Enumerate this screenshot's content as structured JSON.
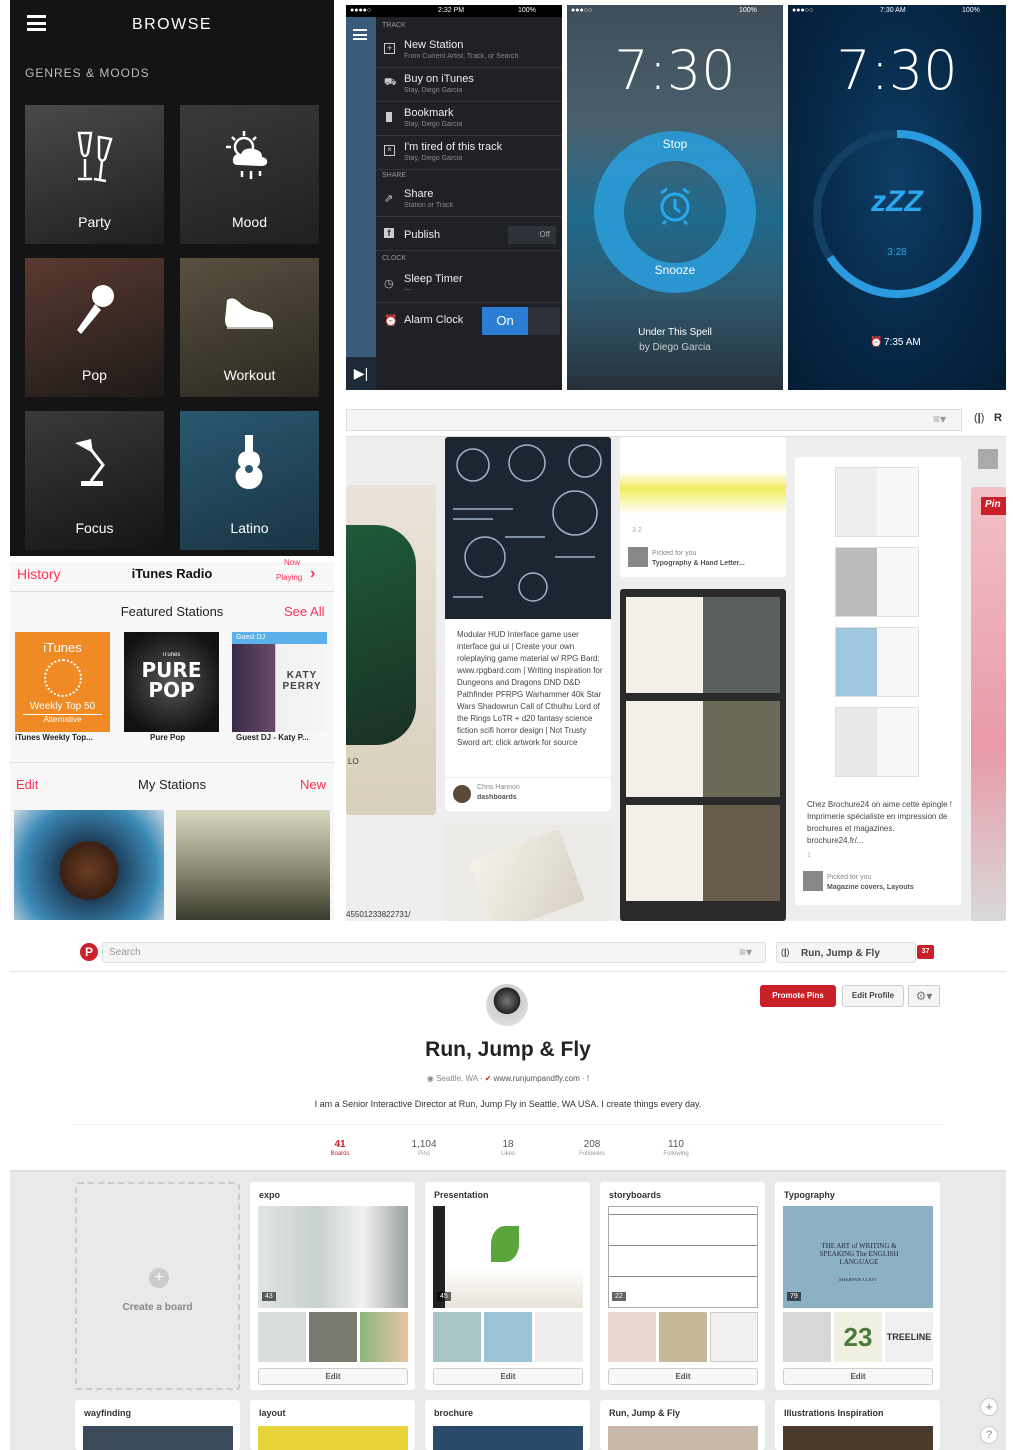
{
  "browse": {
    "title": "BROWSE",
    "section": "GENRES & MOODS",
    "tiles": [
      {
        "label": "Party",
        "icon": "champagne-icon"
      },
      {
        "label": "Mood",
        "icon": "weather-icon"
      },
      {
        "label": "Pop",
        "icon": "microphone-icon"
      },
      {
        "label": "Workout",
        "icon": "sneaker-icon"
      },
      {
        "label": "Focus",
        "icon": "lamp-icon"
      },
      {
        "label": "Latino",
        "icon": "guitar-icon"
      }
    ]
  },
  "track_menu": {
    "status_time": "2:32 PM",
    "battery": "100%",
    "sections": {
      "track": "TRACK",
      "share": "SHARE",
      "clock": "CLOCK"
    },
    "items": [
      {
        "title": "New Station",
        "sub": "From Current Artist, Track, or Search"
      },
      {
        "title": "Buy on iTunes",
        "sub": "Stay, Diego Garcia"
      },
      {
        "title": "Bookmark",
        "sub": "Stay, Diego Garcia"
      },
      {
        "title": "I'm tired of this track",
        "sub": "Stay, Diego Garcia"
      },
      {
        "title": "Share",
        "sub": "Station or Track"
      },
      {
        "title": "Publish",
        "toggle": "Off"
      },
      {
        "title": "Sleep Timer",
        "sub": "---"
      },
      {
        "title": "Alarm Clock",
        "toggle": "On"
      }
    ]
  },
  "alarm": {
    "time": "7:30",
    "stop": "Stop",
    "snooze": "Snooze",
    "song": "Under This Spell",
    "artist": "by Diego Garcia",
    "battery": "100%"
  },
  "sleep": {
    "status_time": "7:30 AM",
    "battery": "100%",
    "time": "7:30",
    "zzz": "zZZ",
    "countdown": "3:28",
    "alarm_at": "7:35 AM"
  },
  "itunes": {
    "history": "History",
    "title": "iTunes Radio",
    "now_playing_1": "Now",
    "now_playing_2": "Playing",
    "featured": "Featured Stations",
    "see_all": "See All",
    "stations": [
      {
        "name": "iTunes Weekly Top...",
        "cover_title": "iTunes",
        "cover_sub": "Weekly Top 50",
        "cover_sub2": "Alternative"
      },
      {
        "name": "Pure Pop",
        "cover_top": "iTunes",
        "cover_title": "PURE POP"
      },
      {
        "name": "Guest DJ - Katy P...",
        "cover_top": "Guest DJ",
        "cover_title": "KATY PERRY"
      }
    ],
    "edit": "Edit",
    "my_stations": "My Stations",
    "new": "New"
  },
  "pin_grid": {
    "account": "R",
    "hud": {
      "desc": "Modular HUD Interface game user interface gui ui | Create your own roleplaying game material w/ RPG Bard: www.rpgbard.com | Writing inspiration for Dungeons and Dragons DND D&D Pathfinder PFRPG Warhammer 40k Star Wars Shadowrun Call of Cthulhu Lord of the Rings LoTR + d20 fantasy science fiction scifi horror design | Not Trusty Sword art: click artwork for source",
      "user": "Chris Hannon",
      "board": "dashboards"
    },
    "typo": {
      "counts": "3   2",
      "picked": "Picked for you",
      "board": "Typography & Hand Letter..."
    },
    "brochure": {
      "desc": "Chez Brochure24 on aime cette épingle ! Imprimerie spécialiste en impression de brochures et magazines. brochure24.fr/...",
      "count": "1",
      "picked": "Picked for you",
      "board": "Magazine covers, Layouts"
    },
    "number": "45501233822731/",
    "lo": "LO",
    "pin_badge": "Pin"
  },
  "profile": {
    "search_placeholder": "Search",
    "user": "Run, Jump & Fly",
    "notif": "37",
    "promote": "Promote Pins",
    "edit_profile": "Edit Profile",
    "name": "Run, Jump & Fly",
    "location": "Seattle, WA",
    "website": "www.runjumpandfly.com",
    "bio": "I am a Senior Interactive Director at Run, Jump Fly in Seattle, WA USA. I create things every day.",
    "stats": [
      {
        "n": "41",
        "l": "Boards"
      },
      {
        "n": "1,104",
        "l": "Pins"
      },
      {
        "n": "18",
        "l": "Likes"
      },
      {
        "n": "208",
        "l": "Followers"
      },
      {
        "n": "110",
        "l": "Following"
      }
    ],
    "create_board": "Create a board",
    "boards": [
      {
        "title": "expo",
        "count": "43",
        "edit": "Edit"
      },
      {
        "title": "Presentation",
        "count": "45",
        "edit": "Edit"
      },
      {
        "title": "storyboards",
        "count": "22",
        "edit": "Edit"
      },
      {
        "title": "Typography",
        "count": "79",
        "edit": "Edit"
      }
    ],
    "boards2": [
      "wayfinding",
      "layout",
      "brochure",
      "Run, Jump & Fly",
      "Illustrations Inspiration"
    ],
    "typo_cover": "THE ART of WRITING & SPEAKING The ENGLISH LANGUAGE",
    "typo_author": "SHERWIN CODY",
    "typo_23": "23",
    "typo_treeline": "TREELINE"
  },
  "colors": {
    "pinterest_red": "#cb2027",
    "itunes_red": "#fc3158",
    "alarm_blue": "#2c9fe0"
  }
}
